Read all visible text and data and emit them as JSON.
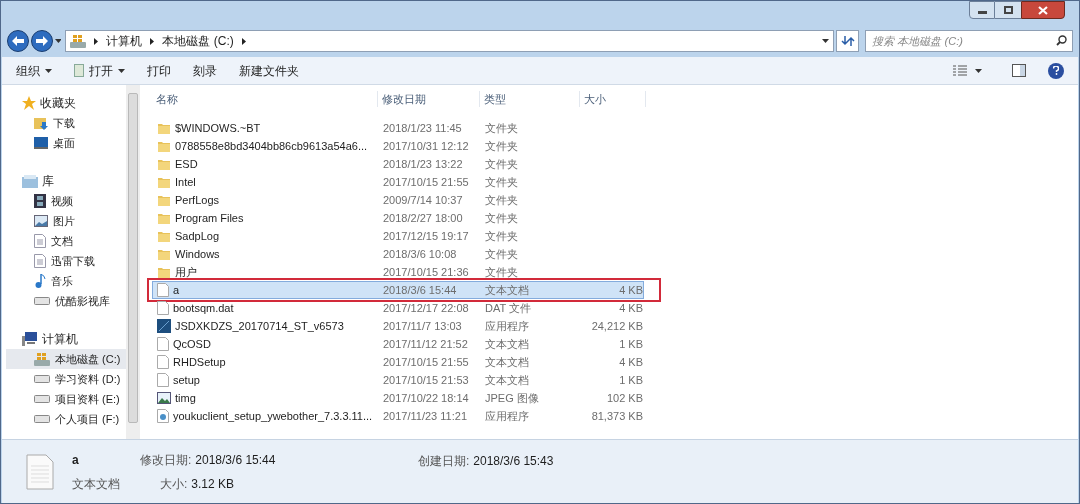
{
  "address_bar": {
    "path": [
      "计算机",
      "本地磁盘 (C:)"
    ]
  },
  "search": {
    "placeholder": "搜索 本地磁盘 (C:)"
  },
  "toolbar": {
    "items": [
      {
        "label": "组织",
        "dropdown": true,
        "icon": false
      },
      {
        "label": "打开",
        "dropdown": true,
        "icon": true
      },
      {
        "label": "打印",
        "dropdown": false,
        "icon": false
      },
      {
        "label": "刻录",
        "dropdown": false,
        "icon": false
      },
      {
        "label": "新建文件夹",
        "dropdown": false,
        "icon": false
      }
    ]
  },
  "sidebar": {
    "groups": [
      {
        "label": "收藏夹",
        "kind": "favorites",
        "children": [
          {
            "label": "下载",
            "kind": "download",
            "selected": false
          },
          {
            "label": "桌面",
            "kind": "desktop",
            "selected": false
          }
        ]
      },
      {
        "label": "库",
        "kind": "library",
        "children": [
          {
            "label": "视频",
            "kind": "video",
            "selected": false
          },
          {
            "label": "图片",
            "kind": "image",
            "selected": false
          },
          {
            "label": "文档",
            "kind": "doc",
            "selected": false
          },
          {
            "label": "迅雷下载",
            "kind": "doc",
            "selected": false
          },
          {
            "label": "音乐",
            "kind": "music",
            "selected": false
          },
          {
            "label": "优酷影视库",
            "kind": "drive",
            "selected": false
          }
        ]
      },
      {
        "label": "计算机",
        "kind": "computer",
        "children": [
          {
            "label": "本地磁盘 (C:)",
            "kind": "system",
            "selected": true
          },
          {
            "label": "学习资料 (D:)",
            "kind": "drive",
            "selected": false
          },
          {
            "label": "项目资料 (E:)",
            "kind": "drive",
            "selected": false
          },
          {
            "label": "个人项目 (F:)",
            "kind": "drive",
            "selected": false
          }
        ]
      }
    ]
  },
  "table": {
    "columns": [
      "名称",
      "修改日期",
      "类型",
      "大小"
    ],
    "rows": [
      {
        "kind": "folder",
        "name": "$WINDOWS.~BT",
        "date": "2018/1/23 11:45",
        "type": "文件夹",
        "selected": false,
        "annotated": false
      },
      {
        "kind": "folder",
        "name": "0788558e8bd3404bb86cb9613a54a6...",
        "date": "2017/10/31 12:12",
        "type": "文件夹",
        "selected": false,
        "annotated": false
      },
      {
        "kind": "folder",
        "name": "ESD",
        "date": "2018/1/23 13:22",
        "type": "文件夹",
        "selected": false,
        "annotated": false
      },
      {
        "kind": "folder",
        "name": "Intel",
        "date": "2017/10/15 21:55",
        "type": "文件夹",
        "selected": false,
        "annotated": false
      },
      {
        "kind": "folder",
        "name": "PerfLogs",
        "date": "2009/7/14 10:37",
        "type": "文件夹",
        "selected": false,
        "annotated": false
      },
      {
        "kind": "folder",
        "name": "Program Files",
        "date": "2018/2/27 18:00",
        "type": "文件夹",
        "selected": false,
        "annotated": false
      },
      {
        "kind": "folder",
        "name": "SadpLog",
        "date": "2017/12/15 19:17",
        "type": "文件夹",
        "selected": false,
        "annotated": false
      },
      {
        "kind": "folder",
        "name": "Windows",
        "date": "2018/3/6 10:08",
        "type": "文件夹",
        "selected": false,
        "annotated": false
      },
      {
        "kind": "folder",
        "name": "用户",
        "date": "2017/10/15 21:36",
        "type": "文件夹",
        "selected": false,
        "annotated": false
      },
      {
        "kind": "text",
        "name": "a",
        "date": "2018/3/6 15:44",
        "type": "文本文档",
        "size": "4 KB",
        "selected": true,
        "annotated": true
      },
      {
        "kind": "text",
        "name": "bootsqm.dat",
        "date": "2017/12/17 22:08",
        "type": "DAT 文件",
        "size": "4 KB",
        "selected": false,
        "annotated": false
      },
      {
        "kind": "app",
        "name": "JSDXKDZS_20170714_ST_v6573",
        "date": "2017/11/7 13:03",
        "type": "应用程序",
        "size": "24,212 KB",
        "selected": false,
        "annotated": false
      },
      {
        "kind": "text",
        "name": "QcOSD",
        "date": "2017/11/12 21:52",
        "type": "文本文档",
        "size": "1 KB",
        "selected": false,
        "annotated": false
      },
      {
        "kind": "text",
        "name": "RHDSetup",
        "date": "2017/10/15 21:55",
        "type": "文本文档",
        "size": "4 KB",
        "selected": false,
        "annotated": false
      },
      {
        "kind": "text",
        "name": "setup",
        "date": "2017/10/15 21:53",
        "type": "文本文档",
        "size": "1 KB",
        "selected": false,
        "annotated": false
      },
      {
        "kind": "image",
        "name": "timg",
        "date": "2017/10/22 18:14",
        "type": "JPEG 图像",
        "size": "102 KB",
        "selected": false,
        "annotated": false
      },
      {
        "kind": "installer",
        "name": "youkuclient_setup_ywebother_7.3.3.11...",
        "date": "2017/11/23 11:21",
        "type": "应用程序",
        "size": "81,373 KB",
        "selected": false,
        "annotated": false
      }
    ]
  },
  "details": {
    "name": "a",
    "type": "文本文档",
    "fields": [
      {
        "label": "修改日期:",
        "value": "2018/3/6 15:44"
      },
      {
        "label": "大小:",
        "value": "3.12 KB"
      },
      {
        "label": "创建日期:",
        "value": "2018/3/6 15:43"
      }
    ]
  }
}
